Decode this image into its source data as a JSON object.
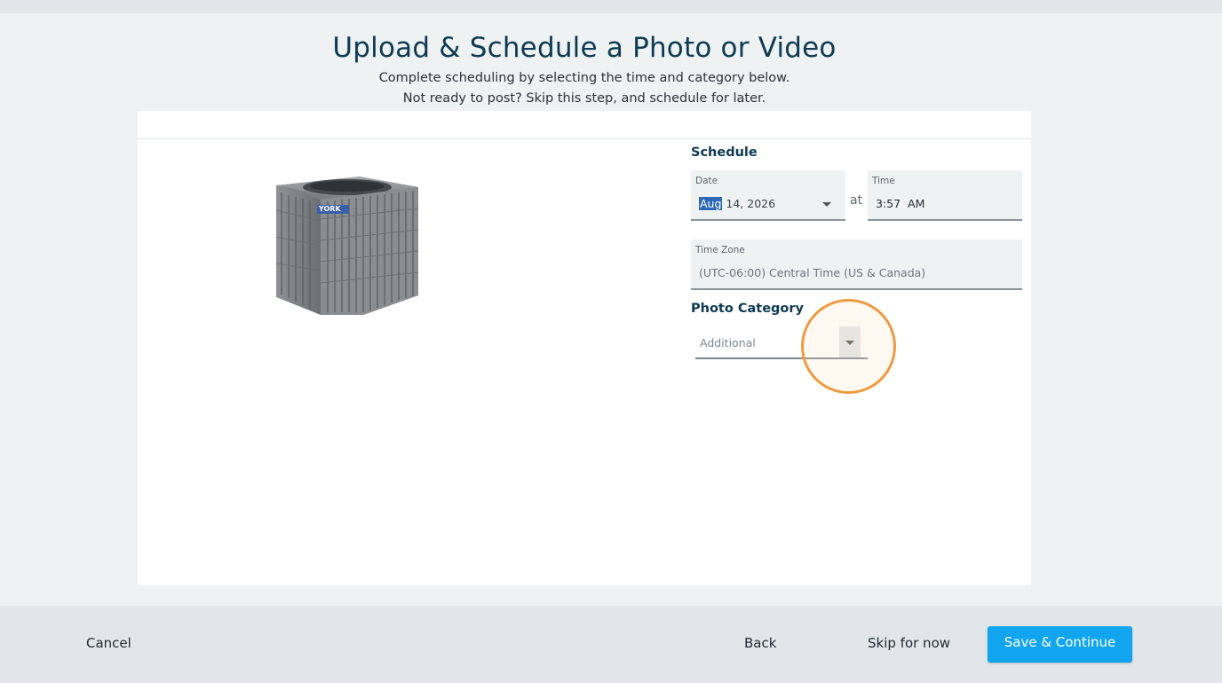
{
  "page": {
    "title": "Upload & Schedule a Photo or Video",
    "subtitle_line1": "Complete scheduling by selecting the time and category below.",
    "subtitle_line2": "Not ready to post? Skip this step, and schedule for later."
  },
  "preview": {
    "image_icon": "air-conditioner-unit-image",
    "brand_label": "YORK"
  },
  "schedule": {
    "heading": "Schedule",
    "date": {
      "label": "Date",
      "value_selected": "Aug",
      "value_rest": " 14, 2026"
    },
    "at_text": "at",
    "time": {
      "label": "Time",
      "value": "3:57  AM"
    },
    "timezone": {
      "label": "Time Zone",
      "value": "(UTC-06:00) Central Time (US & Canada)"
    }
  },
  "category": {
    "heading": "Photo Category",
    "value": "Additional"
  },
  "footer": {
    "cancel": "Cancel",
    "back": "Back",
    "skip": "Skip for now",
    "save": "Save & Continue"
  },
  "colors": {
    "primary_button": "#11a5ef",
    "heading": "#0e3a52",
    "highlight_ring": "#ee9a40"
  }
}
